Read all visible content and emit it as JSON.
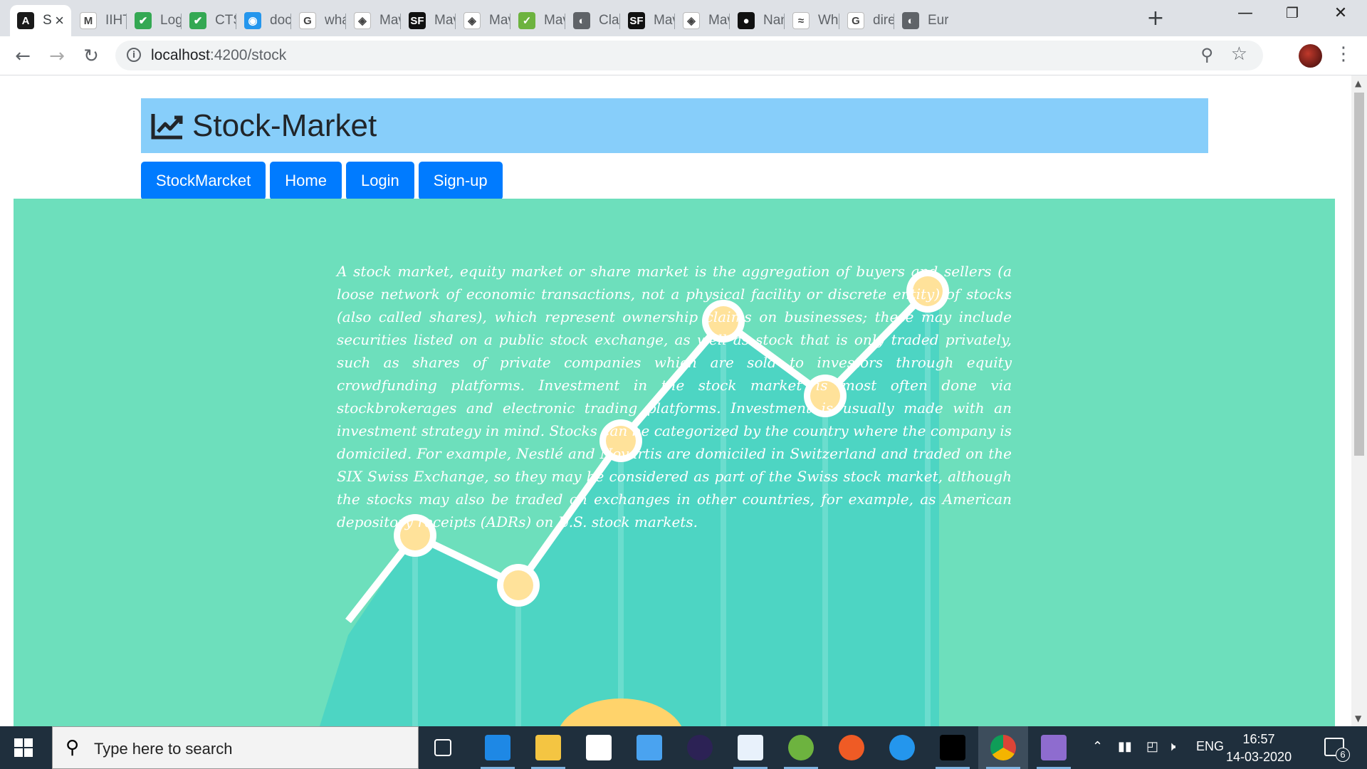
{
  "browser": {
    "tabs": [
      {
        "label": "S",
        "icon": "angular-icon",
        "color": "#1a1a1a",
        "glyph": "A",
        "active": true
      },
      {
        "label": "IIHT",
        "icon": "gmail-icon",
        "color": "#ffffff",
        "glyph": "M"
      },
      {
        "label": "Logi",
        "icon": "check-circle-icon",
        "color": "#34a853",
        "glyph": "✔"
      },
      {
        "label": "CTS",
        "icon": "check-circle-icon",
        "color": "#34a853",
        "glyph": "✔"
      },
      {
        "label": "docl",
        "icon": "docker-icon",
        "color": "#2496ed",
        "glyph": "◉"
      },
      {
        "label": "wha",
        "icon": "google-icon",
        "color": "#ffffff",
        "glyph": "G"
      },
      {
        "label": "Mav",
        "icon": "maven-icon",
        "color": "#ffffff",
        "glyph": "◈"
      },
      {
        "label": "Mav",
        "icon": "sf-icon",
        "color": "#111111",
        "glyph": "SF"
      },
      {
        "label": "Mav",
        "icon": "maven-icon",
        "color": "#ffffff",
        "glyph": "◈"
      },
      {
        "label": "Mav",
        "icon": "leaf-icon",
        "color": "#6db33f",
        "glyph": "✓"
      },
      {
        "label": "Clas",
        "icon": "globe-icon",
        "color": "#5f6368",
        "glyph": "◐"
      },
      {
        "label": "Mav",
        "icon": "sf-icon",
        "color": "#111111",
        "glyph": "SF"
      },
      {
        "label": "Mav",
        "icon": "maven-icon",
        "color": "#ffffff",
        "glyph": "◈"
      },
      {
        "label": "Nan",
        "icon": "github-icon",
        "color": "#111111",
        "glyph": "●"
      },
      {
        "label": "Whi",
        "icon": "wave-icon",
        "color": "#ffffff",
        "glyph": "≈"
      },
      {
        "label": "dire",
        "icon": "google-icon",
        "color": "#ffffff",
        "glyph": "G"
      },
      {
        "label": "Eure",
        "icon": "globe-icon",
        "color": "#5f6368",
        "glyph": "◐"
      }
    ],
    "url_host": "localhost",
    "url_path": ":4200/stock"
  },
  "app": {
    "title": "Stock-Market",
    "title_icon": "chart-line-icon",
    "nav": [
      "StockMarcket",
      "Home",
      "Login",
      "Sign-up"
    ],
    "description": "A stock market, equity market or share market is the aggregation of buyers and sellers (a loose network of economic transactions, not a physical facility or discrete entity) of stocks (also called shares), which represent ownership claims on businesses; these may include securities listed on a public stock exchange, as well as stock that is only traded privately, such as shares of private companies which are sold to investors through equity crowdfunding platforms. Investment in the stock market is most often done via stockbrokerages and electronic trading platforms. Investment is usually made with an investment strategy in mind. Stocks can be categorized by the country where the company is domiciled. For example, Nestlé and Novartis are domiciled in Switzerland and traded on the SIX Swiss Exchange, so they may be considered as part of the Swiss stock market, although the stocks may also be traded on exchanges in other countries, for example, as American depository receipts (ADRs) on U.S. stock markets.",
    "colors": {
      "header_bg": "#87cefa",
      "nav_bg": "#007bff",
      "hero_bg": "#6ddfbc",
      "chart_fill": "#4dd5c3",
      "chart_line": "#ffffff",
      "point_fill": "#ffe29a"
    },
    "illustration_trend": [
      0.12,
      0.02,
      0.31,
      0.55,
      0.4,
      0.61
    ]
  },
  "taskbar": {
    "search_placeholder": "Type here to search",
    "apps": [
      "task-view-icon",
      "edge-icon",
      "file-explorer-icon",
      "store-icon",
      "mail-icon",
      "eclipse-icon",
      "workbench-icon",
      "spring-icon",
      "postman-icon",
      "docker-icon",
      "terminal-icon",
      "chrome-icon",
      "git-icon"
    ],
    "language": "ENG",
    "time": "16:57",
    "date": "14-03-2020",
    "notifications": "6"
  }
}
